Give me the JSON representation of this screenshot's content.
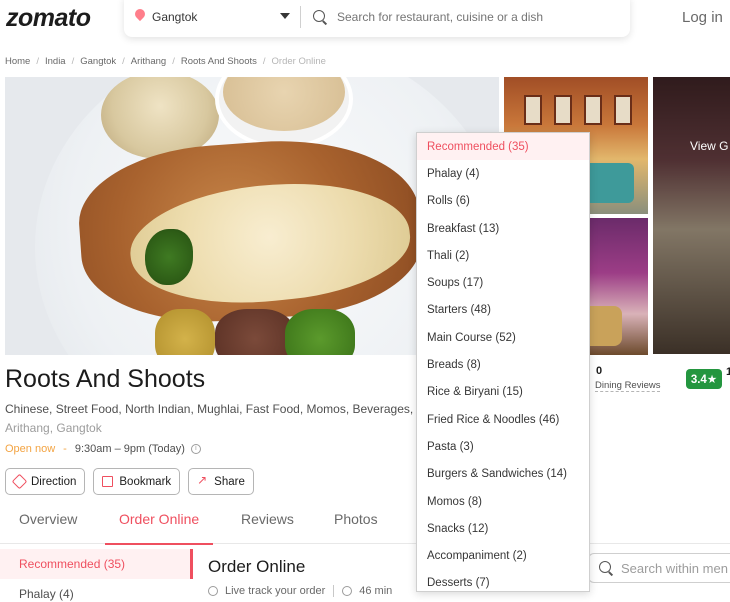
{
  "header": {
    "logo": "zomato",
    "location": "Gangtok",
    "search_placeholder": "Search for restaurant, cuisine or a dish",
    "login": "Log in"
  },
  "breadcrumb": [
    "Home",
    "India",
    "Gangtok",
    "Arithang",
    "Roots And Shoots",
    "Order Online"
  ],
  "gallery": {
    "view_gallery": "View G"
  },
  "restaurant": {
    "name": "Roots And Shoots",
    "cuisines": "Chinese, Street Food, North Indian, Mughlai, Fast Food, Momos, Beverages,",
    "locality": "Arithang, Gangtok",
    "open_status": "Open now",
    "dash": "-",
    "hours": "9:30am – 9pm (Today)",
    "dining_count": "0",
    "dining_label": "Dining Reviews",
    "rating": "3.4★",
    "second_count": "1"
  },
  "actions": [
    "Direction",
    "Bookmark",
    "Share"
  ],
  "tabs": [
    "Overview",
    "Order Online",
    "Reviews",
    "Photos"
  ],
  "side_menu": [
    "Recommended (35)",
    "Phalay (4)"
  ],
  "order": {
    "title": "Order Online",
    "track": "Live track your order",
    "time": "46 min",
    "search_placeholder": "Search within men"
  },
  "dropdown": [
    "Recommended (35)",
    "Phalay (4)",
    "Rolls (6)",
    "Breakfast (13)",
    "Thali (2)",
    "Soups (17)",
    "Starters (48)",
    "Main Course (52)",
    "Breads (8)",
    "Rice & Biryani (15)",
    "Fried Rice & Noodles (46)",
    "Pasta (3)",
    "Burgers & Sandwiches (14)",
    "Momos (8)",
    "Snacks (12)",
    "Accompaniment (2)",
    "Desserts (7)"
  ],
  "colors": {
    "accent": "#ef4f5f",
    "rating_green": "#24963f",
    "open": "#f3a443"
  }
}
